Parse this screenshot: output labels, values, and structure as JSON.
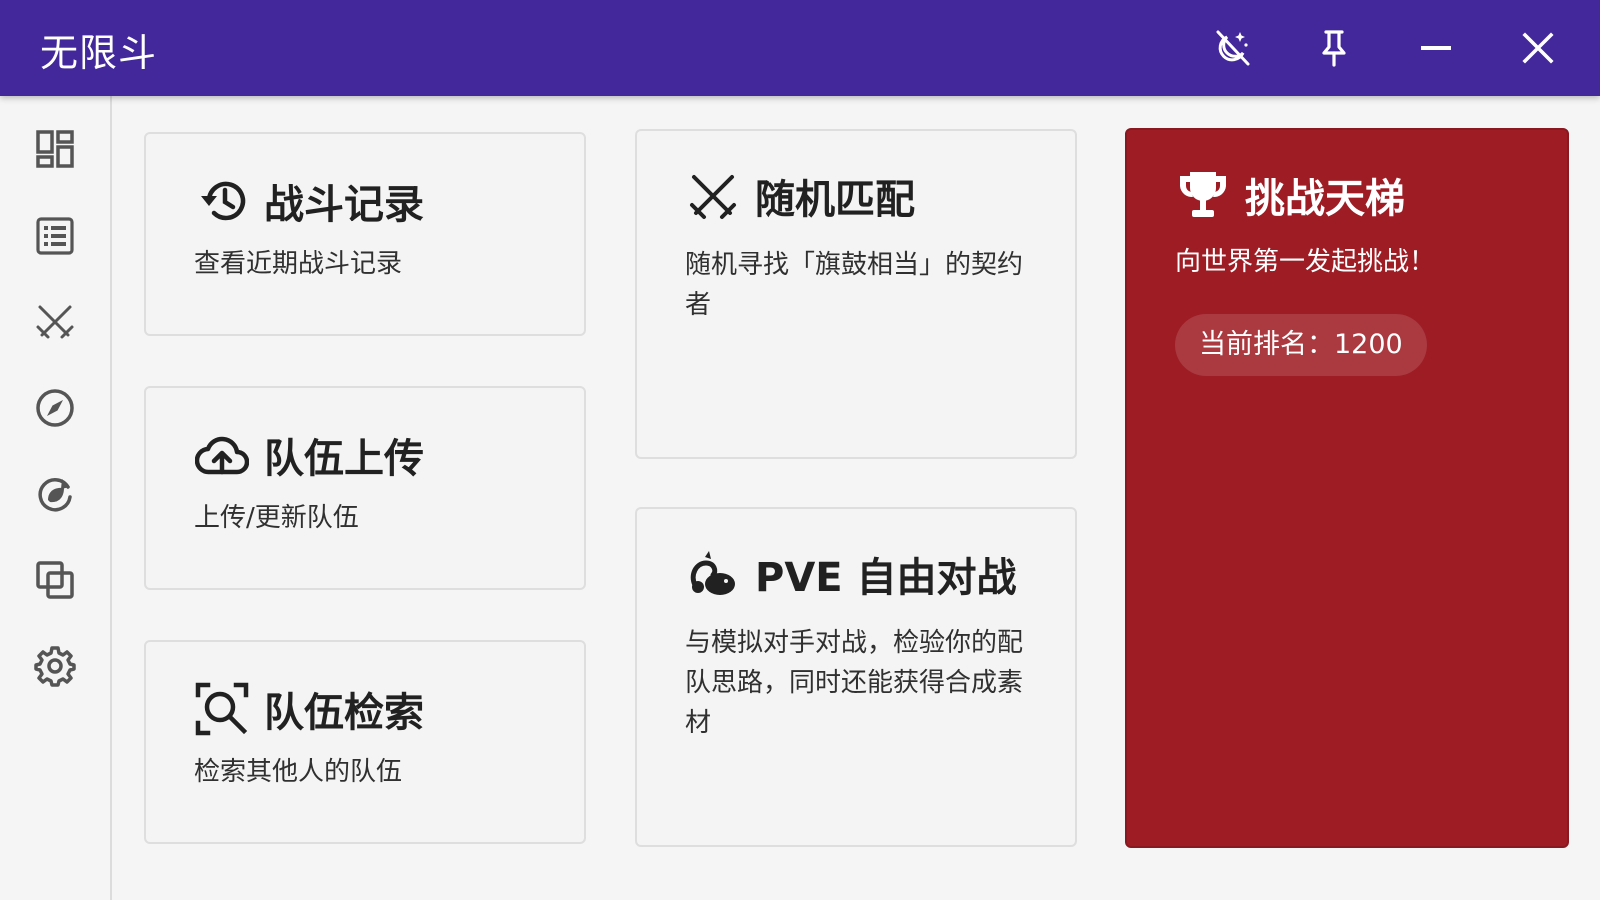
{
  "app": {
    "title": "无限斗"
  },
  "titlebar": {
    "buttons": [
      {
        "icon": "theme-toggle-icon"
      },
      {
        "icon": "pin-icon"
      },
      {
        "icon": "minimize-icon"
      },
      {
        "icon": "close-icon"
      }
    ]
  },
  "sidebar": {
    "items": [
      {
        "icon": "dashboard-icon"
      },
      {
        "icon": "list-icon"
      },
      {
        "icon": "crossed-swords-icon"
      },
      {
        "icon": "compass-icon"
      },
      {
        "icon": "refresh-leaf-icon"
      },
      {
        "icon": "copy-icon"
      },
      {
        "icon": "gear-icon"
      }
    ]
  },
  "cards": {
    "battle_records": {
      "title": "战斗记录",
      "desc": "查看近期战斗记录",
      "icon": "history-icon"
    },
    "team_upload": {
      "title": "队伍上传",
      "desc": "上传/更新队伍",
      "icon": "cloud-upload-icon"
    },
    "team_search": {
      "title": "队伍检索",
      "desc": "检索其他人的队伍",
      "icon": "search-icon"
    },
    "random_match": {
      "title": "随机匹配",
      "desc": "随机寻找「旗鼓相当」的契约者",
      "icon": "crossed-swords-icon"
    },
    "pve": {
      "title": "PVE 自由对战",
      "desc": "与模拟对手对战，检验你的配队思路，同时还能获得合成素材",
      "icon": "creature-icon"
    },
    "ladder": {
      "title": "挑战天梯",
      "desc": "向世界第一发起挑战！",
      "rank": "当前排名：1200",
      "icon": "trophy-icon"
    }
  },
  "colors": {
    "titlebar": "#43289b",
    "ladder": "#9e1c24",
    "background": "#f5f5f5"
  }
}
